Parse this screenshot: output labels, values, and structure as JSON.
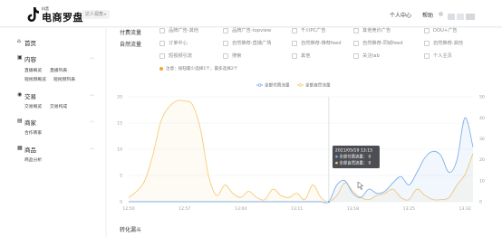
{
  "header": {
    "logo_small": "抖音",
    "logo_main": "电商罗盘",
    "role_select": "达人视角",
    "links": [
      "个人中心",
      "帮助"
    ]
  },
  "sidebar": {
    "sections": [
      {
        "label": "首页",
        "icon": "home-icon",
        "subitems": []
      },
      {
        "label": "内容",
        "icon": "content-icon",
        "subitems": [
          "直播概览",
          "直播列表",
          "短视频概览",
          "短视频列表"
        ]
      },
      {
        "label": "交易",
        "icon": "trade-icon",
        "subitems": [
          "交易概览",
          "交易构成"
        ]
      },
      {
        "label": "商家",
        "icon": "merchant-icon",
        "subitems": [
          "合作商家"
        ]
      },
      {
        "label": "商品",
        "icon": "product-icon",
        "subitems": [
          "商品分析"
        ]
      }
    ]
  },
  "filters": {
    "paid_label": "付费流量",
    "natural_label": "自然流量",
    "paid_options": [
      "品牌广告-其他",
      "品牌广告-topview",
      "千川PC广告",
      "其他竞价广告",
      "DOU+广告"
    ],
    "natural_options": [
      "订单中心",
      "自然推荐-直播广场",
      "自然推荐-推荐feed",
      "自然推荐-同城feed",
      "自然推荐-其他",
      "短视频引流",
      "搜索",
      "其他",
      "关注tab",
      "个人主页"
    ],
    "note": "注意：按钮最少选择1个，最多选择2个"
  },
  "legend": [
    "全部付费流量",
    "全部自然流量"
  ],
  "colors": {
    "paid": "#7fb0ea",
    "natural": "#f8cb78",
    "accent": "#f5a623"
  },
  "tooltip": {
    "title": "2021/05/19 13:15",
    "rows": [
      {
        "label": "全部付费流量：",
        "value": "0"
      },
      {
        "label": "全部自然流量：",
        "value": "0"
      }
    ]
  },
  "chart_data": {
    "type": "line",
    "x_tick_labels": [
      "12:50",
      "12:57",
      "13:04",
      "13:11",
      "13:18",
      "13:25",
      "13:32"
    ],
    "y_left_ticks": [
      0,
      5,
      10,
      15,
      20
    ],
    "y_right_ticks": [
      0,
      10,
      20,
      30,
      40,
      50
    ],
    "ylim_left": [
      0,
      20
    ],
    "ylim_right": [
      0,
      50
    ],
    "x": [
      "12:50",
      "12:51",
      "12:52",
      "12:53",
      "12:54",
      "12:55",
      "12:56",
      "12:57",
      "12:58",
      "12:59",
      "13:00",
      "13:01",
      "13:02",
      "13:03",
      "13:04",
      "13:05",
      "13:06",
      "13:07",
      "13:08",
      "13:09",
      "13:10",
      "13:11",
      "13:12",
      "13:13",
      "13:14",
      "13:15",
      "13:16",
      "13:17",
      "13:18",
      "13:19",
      "13:20",
      "13:21",
      "13:22",
      "13:23",
      "13:24",
      "13:25",
      "13:26",
      "13:27",
      "13:28",
      "13:29",
      "13:30",
      "13:31",
      "13:32",
      "13:33"
    ],
    "series": [
      {
        "name": "全部付费流量",
        "axis": "left",
        "values": [
          0,
          0,
          0,
          0,
          0,
          0,
          0,
          0,
          0,
          0,
          0,
          0,
          0,
          0,
          0,
          0,
          0,
          0,
          0,
          0,
          0,
          0,
          0,
          0,
          0,
          0,
          0,
          0,
          0,
          0,
          0,
          0,
          0,
          0,
          0,
          0,
          0,
          0,
          0,
          0,
          0,
          0,
          0,
          0
        ]
      },
      {
        "name": "全部自然流量",
        "axis": "right",
        "values": [
          2,
          5,
          10,
          22,
          38,
          45,
          48,
          48,
          46,
          34,
          12,
          3,
          8,
          4,
          2,
          5,
          2,
          1,
          6,
          3,
          2,
          4,
          1,
          8,
          2,
          0,
          3,
          9,
          5,
          2,
          1,
          3,
          4,
          6,
          2,
          1,
          6,
          3,
          1,
          1,
          2,
          8,
          13,
          23
        ]
      }
    ],
    "series_blue": {
      "name": "全部付费流量",
      "axis": "right",
      "values": [
        0,
        0,
        0,
        0,
        0,
        0,
        0,
        0,
        0,
        0,
        0,
        0,
        0,
        0,
        0,
        0,
        0,
        0,
        0,
        0,
        0,
        0,
        0,
        0,
        0,
        0,
        8,
        10,
        4,
        2,
        6,
        4,
        5,
        9,
        12,
        8,
        14,
        21,
        24,
        22,
        14,
        20,
        40,
        26
      ]
    },
    "grid": true,
    "legend_position": "top-center"
  }
}
